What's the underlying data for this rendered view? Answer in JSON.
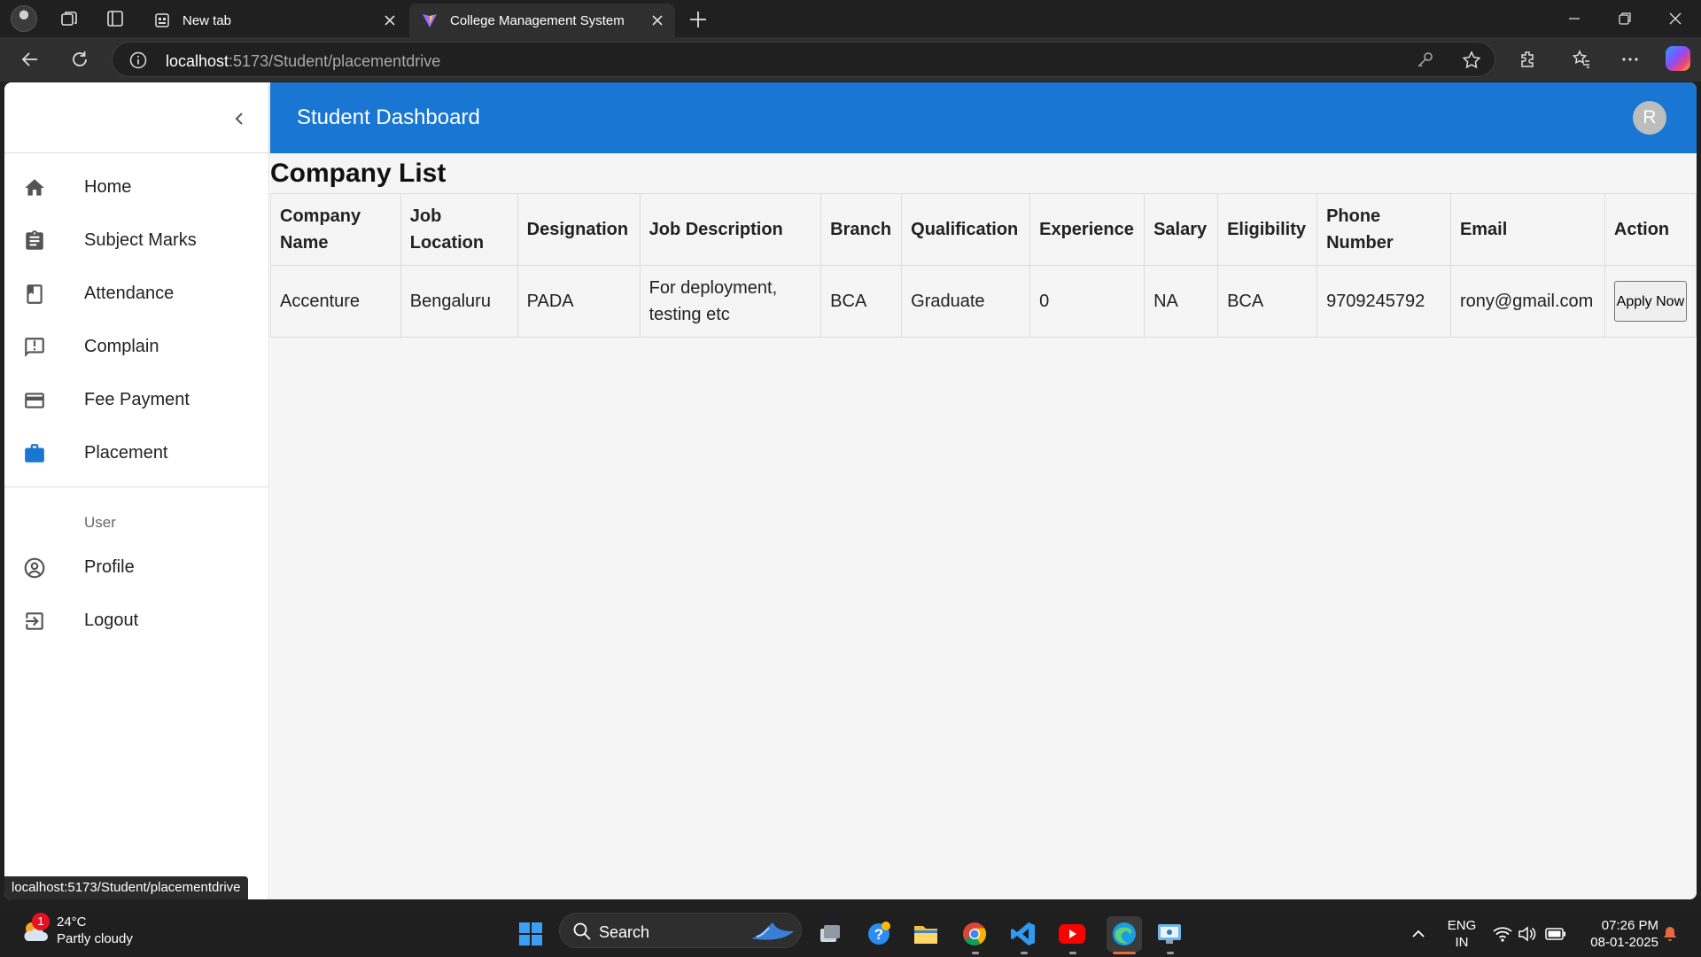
{
  "browser": {
    "tabs": [
      {
        "label": "New tab"
      },
      {
        "label": "College Management System"
      }
    ],
    "url_host": "localhost",
    "url_rest": ":5173/Student/placementdrive",
    "status_url": "localhost:5173/Student/placementdrive"
  },
  "app": {
    "title": "Student Dashboard",
    "user_initial": "R",
    "sidebar": {
      "items": [
        {
          "label": "Home"
        },
        {
          "label": "Subject Marks"
        },
        {
          "label": "Attendance"
        },
        {
          "label": "Complain"
        },
        {
          "label": "Fee Payment"
        },
        {
          "label": "Placement"
        }
      ],
      "section": "User",
      "user_items": [
        {
          "label": "Profile"
        },
        {
          "label": "Logout"
        }
      ]
    },
    "page_heading": "Company List",
    "table": {
      "headers": [
        "Company Name",
        "Job Location",
        "Designation",
        "Job Description",
        "Branch",
        "Qualification",
        "Experience",
        "Salary",
        "Eligibility",
        "Phone Number",
        "Email",
        "Action"
      ],
      "rows": [
        {
          "company": "Accenture",
          "location": "Bengaluru",
          "designation": "PADA",
          "description": "For deployment, testing etc",
          "branch": "BCA",
          "qualification": "Graduate",
          "experience": "0",
          "salary": "NA",
          "eligibility": "BCA",
          "phone": "9709245792",
          "email": "rony@gmail.com",
          "action": "Apply Now"
        }
      ]
    }
  },
  "taskbar": {
    "weather_badge": "1",
    "temperature": "24°C",
    "weather": "Partly cloudy",
    "search_label": "Search",
    "lang_top": "ENG",
    "lang_bottom": "IN",
    "time": "07:26 PM",
    "date": "08-01-2025"
  },
  "colors": {
    "appbar": "#1976d2",
    "placement_icon": "#1976d2"
  }
}
